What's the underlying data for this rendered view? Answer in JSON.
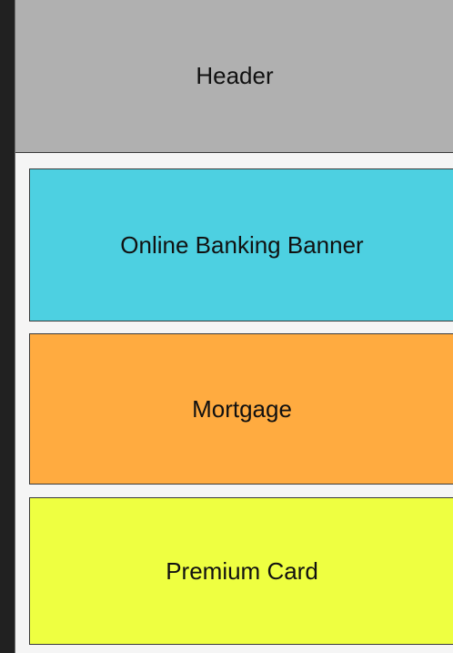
{
  "blocks": {
    "header": {
      "label": "Header",
      "color": "#b0b0b0"
    },
    "banner": {
      "label": "Online Banking Banner",
      "color": "#4dd0e1"
    },
    "mortgage": {
      "label": "Mortgage",
      "color": "#ffab40"
    },
    "premium_card": {
      "label": "Premium Card",
      "color": "#eeff41"
    }
  },
  "colors": {
    "background": "#212121",
    "page": "#f5f5f5",
    "border": "#3a3a3a"
  }
}
